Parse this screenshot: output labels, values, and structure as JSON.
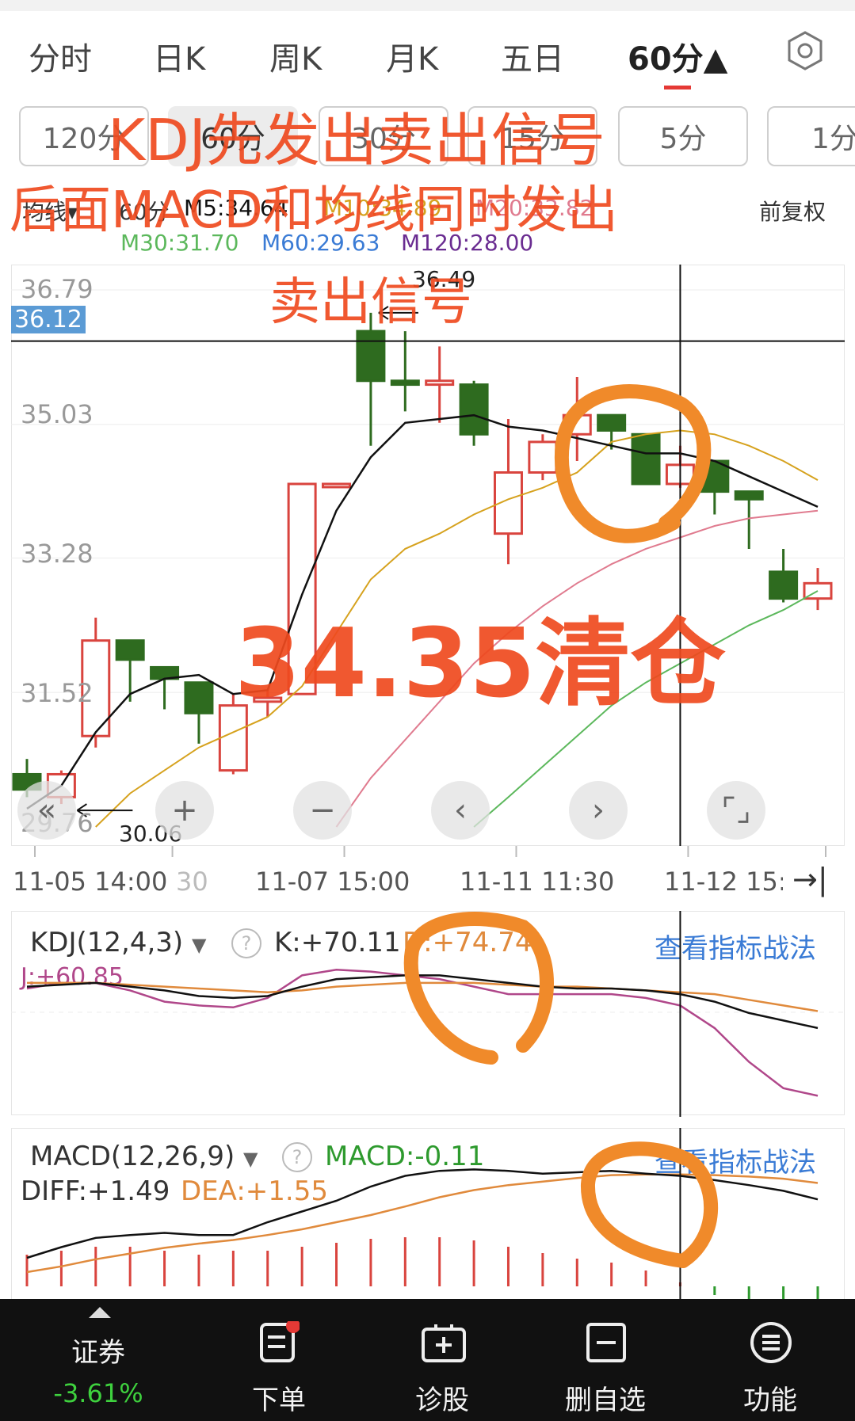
{
  "tabs": [
    {
      "label": "分时",
      "active": false
    },
    {
      "label": "日K",
      "active": false
    },
    {
      "label": "周K",
      "active": false
    },
    {
      "label": "月K",
      "active": false
    },
    {
      "label": "五日",
      "active": false
    },
    {
      "label": "60分▲",
      "active": true
    }
  ],
  "period_pills": [
    {
      "label": "120分",
      "selected": false
    },
    {
      "label": "60分",
      "selected": true
    },
    {
      "label": "30分",
      "selected": false
    },
    {
      "label": "15分",
      "selected": false
    },
    {
      "label": "5分",
      "selected": false
    },
    {
      "label": "1分",
      "selected": false
    }
  ],
  "ma_header": {
    "label": "均线",
    "period": "60分",
    "m5": "M5:34.64",
    "m10": "M10:34.89",
    "m20": "M20:33.82",
    "m30": "M30:31.70",
    "m60": "M60:29.63",
    "m120": "M120:28.00",
    "adjust": "前复权"
  },
  "price_axis": {
    "ticks": [
      "36.79",
      "35.03",
      "33.28",
      "31.52",
      "29.76"
    ],
    "crosshair_price": "36.12",
    "high_marker": "36.49",
    "low_marker": "30.06"
  },
  "time_axis": {
    "labels": [
      "11-05 14:00",
      "30",
      "11-07 15:00",
      "11-11 11:30",
      "11-12 15:"
    ]
  },
  "kdj": {
    "name": "KDJ(12,4,3)",
    "k": "K:+70.11",
    "d": "D:+74.74",
    "j": "J:+60.85",
    "link": "查看指标战法"
  },
  "macd": {
    "name": "MACD(12,26,9)",
    "macd": "MACD:-0.11",
    "diff": "DIFF:+1.49",
    "dea": "DEA:+1.55",
    "link": "查看指标战法"
  },
  "bottom_nav": [
    {
      "label": "证券",
      "sub": "-3.61%",
      "icon": "up-triangle-icon"
    },
    {
      "label": "下单",
      "icon": "order-doc-icon"
    },
    {
      "label": "诊股",
      "icon": "diagnose-icon"
    },
    {
      "label": "删自选",
      "icon": "remove-watchlist-icon"
    },
    {
      "label": "功能",
      "icon": "menu-circle-icon"
    }
  ],
  "annotations": {
    "line1": "KDJ先发出卖出信号",
    "line2": "后面MACD和均线同时发出",
    "line3": "卖出信号",
    "big": "34.35清仓"
  },
  "colors": {
    "up": "#d9443e",
    "down": "#2e6b1f",
    "ma5": "#111111",
    "ma10": "#d6a21e",
    "ma20": "#e07b8f",
    "ma30": "#5cb85c",
    "annotation": "#ef4a1f",
    "circle": "#f08a2a",
    "link": "#3a7bd5"
  },
  "chart_data": {
    "type": "candlestick",
    "interval": "60分",
    "ylim": [
      29.76,
      36.79
    ],
    "candles": [
      {
        "o": 30.45,
        "h": 30.65,
        "l": 30.15,
        "c": 30.25
      },
      {
        "o": 30.15,
        "h": 30.5,
        "l": 30.06,
        "c": 30.45
      },
      {
        "o": 30.95,
        "h": 32.5,
        "l": 30.8,
        "c": 32.2
      },
      {
        "o": 32.2,
        "h": 32.2,
        "l": 31.4,
        "c": 31.95
      },
      {
        "o": 31.85,
        "h": 31.85,
        "l": 31.3,
        "c": 31.7
      },
      {
        "o": 31.65,
        "h": 31.65,
        "l": 30.85,
        "c": 31.25
      },
      {
        "o": 30.5,
        "h": 31.5,
        "l": 30.45,
        "c": 31.35
      },
      {
        "o": 31.4,
        "h": 31.55,
        "l": 31.2,
        "c": 31.45
      },
      {
        "o": 31.5,
        "h": 34.25,
        "l": 31.5,
        "c": 34.25
      },
      {
        "o": 34.25,
        "h": 34.25,
        "l": 34.25,
        "c": 34.25
      },
      {
        "o": 36.25,
        "h": 36.49,
        "l": 34.75,
        "c": 35.6
      },
      {
        "o": 35.6,
        "h": 36.25,
        "l": 35.2,
        "c": 35.55
      },
      {
        "o": 35.55,
        "h": 36.05,
        "l": 35.05,
        "c": 35.6
      },
      {
        "o": 35.55,
        "h": 35.6,
        "l": 34.75,
        "c": 34.9
      },
      {
        "o": 33.6,
        "h": 35.1,
        "l": 33.2,
        "c": 34.4
      },
      {
        "o": 34.4,
        "h": 34.9,
        "l": 34.3,
        "c": 34.8
      },
      {
        "o": 34.9,
        "h": 35.65,
        "l": 34.55,
        "c": 35.15
      },
      {
        "o": 35.15,
        "h": 35.15,
        "l": 34.7,
        "c": 34.95
      },
      {
        "o": 34.9,
        "h": 34.9,
        "l": 34.25,
        "c": 34.25
      },
      {
        "o": 34.25,
        "h": 34.75,
        "l": 34.2,
        "c": 34.5
      },
      {
        "o": 34.55,
        "h": 34.55,
        "l": 33.85,
        "c": 34.15
      },
      {
        "o": 34.15,
        "h": 34.15,
        "l": 33.4,
        "c": 34.05
      },
      {
        "o": 33.1,
        "h": 33.4,
        "l": 32.7,
        "c": 32.75
      },
      {
        "o": 32.75,
        "h": 33.15,
        "l": 32.6,
        "c": 32.95
      }
    ],
    "ma5": [
      30.0,
      30.3,
      31.0,
      31.5,
      31.7,
      31.75,
      31.5,
      31.55,
      32.8,
      33.9,
      34.6,
      35.05,
      35.1,
      35.15,
      35.0,
      34.95,
      34.85,
      34.75,
      34.65,
      34.65,
      34.55,
      34.35,
      34.15,
      33.95
    ],
    "ma10": [
      null,
      null,
      29.76,
      30.2,
      30.5,
      30.8,
      31.0,
      31.2,
      31.6,
      32.3,
      33.0,
      33.4,
      33.6,
      33.85,
      34.05,
      34.2,
      34.4,
      34.8,
      34.9,
      34.95,
      34.9,
      34.75,
      34.55,
      34.3
    ],
    "ma20": [
      null,
      null,
      null,
      null,
      null,
      null,
      null,
      null,
      null,
      29.76,
      30.4,
      30.9,
      31.4,
      31.9,
      32.3,
      32.65,
      32.95,
      33.2,
      33.4,
      33.55,
      33.7,
      33.8,
      33.85,
      33.9
    ],
    "ma30": [
      null,
      null,
      null,
      null,
      null,
      null,
      null,
      null,
      null,
      null,
      null,
      null,
      null,
      29.76,
      30.15,
      30.55,
      30.95,
      31.35,
      31.65,
      31.9,
      32.15,
      32.4,
      32.6,
      32.85
    ],
    "kdj_k": [
      80,
      81,
      82,
      80,
      78,
      75,
      74,
      75,
      80,
      84,
      85,
      86,
      86,
      84,
      82,
      80,
      79,
      79,
      78,
      76,
      72,
      66,
      62,
      58
    ],
    "kdj_d": [
      82,
      82,
      82,
      81,
      80,
      79,
      78,
      77,
      78,
      80,
      81,
      82,
      82,
      82,
      81,
      80,
      80,
      79,
      78,
      77,
      76,
      73,
      70,
      67
    ],
    "kdj_j": [
      79,
      82,
      82,
      78,
      72,
      70,
      69,
      74,
      86,
      89,
      88,
      86,
      84,
      80,
      76,
      76,
      76,
      76,
      74,
      70,
      58,
      40,
      26,
      22
    ],
    "diff": [
      0.4,
      0.55,
      0.68,
      0.72,
      0.75,
      0.72,
      0.72,
      0.9,
      1.05,
      1.2,
      1.4,
      1.55,
      1.62,
      1.64,
      1.62,
      1.58,
      1.6,
      1.62,
      1.58,
      1.55,
      1.49,
      1.42,
      1.34,
      1.22
    ],
    "dea": [
      0.2,
      0.28,
      0.38,
      0.46,
      0.54,
      0.6,
      0.65,
      0.72,
      0.8,
      0.9,
      1.0,
      1.12,
      1.25,
      1.35,
      1.42,
      1.47,
      1.52,
      1.56,
      1.57,
      1.57,
      1.56,
      1.54,
      1.51,
      1.45
    ],
    "macd_hist": [
      0.4,
      0.45,
      0.5,
      0.5,
      0.45,
      0.4,
      0.45,
      0.45,
      0.5,
      0.55,
      0.6,
      0.62,
      0.62,
      0.58,
      0.5,
      0.42,
      0.35,
      0.3,
      0.2,
      0.05,
      -0.11,
      -0.2,
      -0.25,
      -0.3
    ]
  }
}
